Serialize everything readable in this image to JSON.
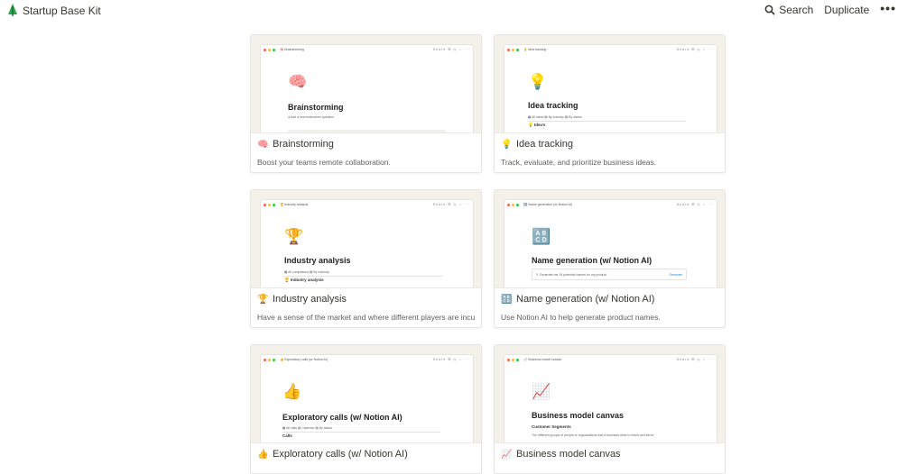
{
  "header": {
    "title": "Startup Base Kit",
    "search_label": "Search",
    "duplicate_label": "Duplicate",
    "more_label": "•••"
  },
  "preview_window": {
    "share_label": "Share",
    "toolbar_icons": "☰ ◷ ☆ ···"
  },
  "cards": [
    {
      "icon": "🧠",
      "title": "Brainstorming",
      "description": "Boost your teams remote collaboration.",
      "preview": {
        "crumb": "🧠 Brainstorming",
        "icon": "🧠",
        "title": "Brainstorming",
        "sub": "● Add a new brainstorm question",
        "sub2": ""
      }
    },
    {
      "icon": "💡",
      "title": "Idea tracking",
      "description": "Track, evaluate, and prioritize business ideas.",
      "preview": {
        "crumb": "💡 Idea tracking",
        "icon": "💡",
        "title": "Idea tracking",
        "sub": "▦ All ideas   ▤ By industry   ▤ By status",
        "sub2": "💡 Idea's"
      }
    },
    {
      "icon": "🏆",
      "title": "Industry analysis",
      "description": "Have a sense of the market and where different players are incumbent",
      "preview": {
        "crumb": "🏆 Industry analysis",
        "icon": "🏆",
        "title": "Industry analysis",
        "sub": "▦ All competitors   ▤ By Industry",
        "sub2": "🏆 Industry analysis"
      }
    },
    {
      "icon": "🔠",
      "title": "Name generation (w/ Notion AI)",
      "description": "Use Notion AI to help generate product names.",
      "preview": {
        "crumb": "🔠 Name generation (w/ Notion AI)",
        "icon": "🔠",
        "title": "Name generation (w/ Notion AI)",
        "sub": "",
        "sub2": "",
        "box_text": "✎  Generate me 15 potential names for my product",
        "box_action": "Generate"
      }
    },
    {
      "icon": "👍",
      "title": "Exploratory calls (w/ Notion AI)",
      "description": "",
      "preview": {
        "crumb": "👍 Exploratory calls (w/ Notion AI)",
        "icon": "👍",
        "title": "Exploratory calls (w/ Notion AI)",
        "sub": "▦ All calls   ▤ Calendar   ▤ By status",
        "sub2": "Calls"
      }
    },
    {
      "icon": "📈",
      "title": "Business model canvas",
      "description": "",
      "preview": {
        "crumb": "📈 Business model canvas",
        "icon": "📈",
        "title": "Business model canvas",
        "sub": "",
        "sub2": "Customer Segments",
        "sub3": "The different groups of people or organizations that a business aims to reach and serve."
      }
    }
  ]
}
